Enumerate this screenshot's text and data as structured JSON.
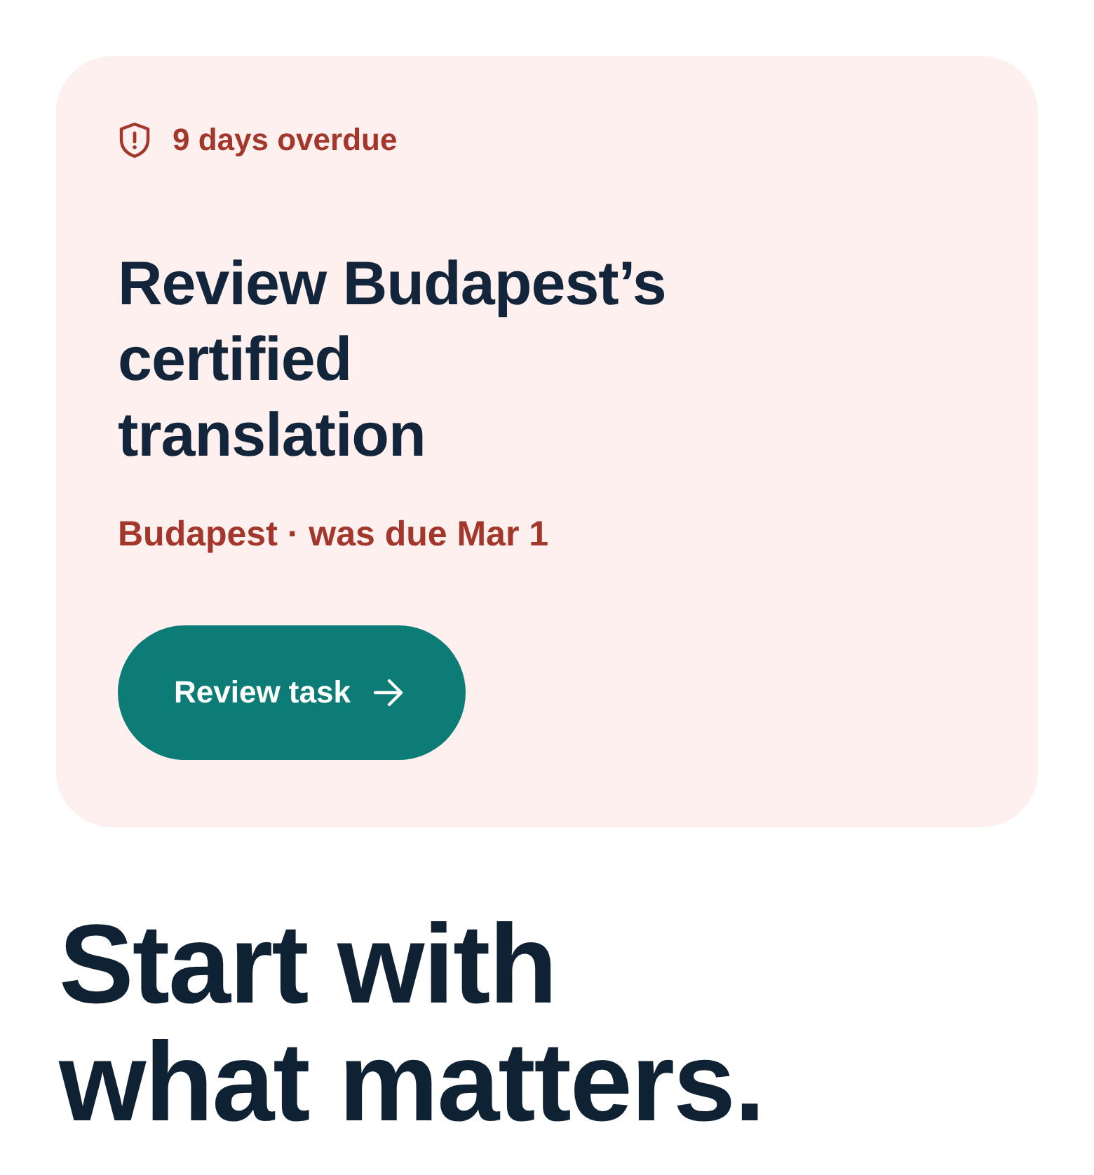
{
  "alert_card": {
    "status": {
      "text": "9 days overdue"
    },
    "title": "Review Budapest’s certified translation",
    "meta": "Budapest · was due Mar 1",
    "button": {
      "label": "Review task"
    }
  },
  "headline": "Start with what matters."
}
